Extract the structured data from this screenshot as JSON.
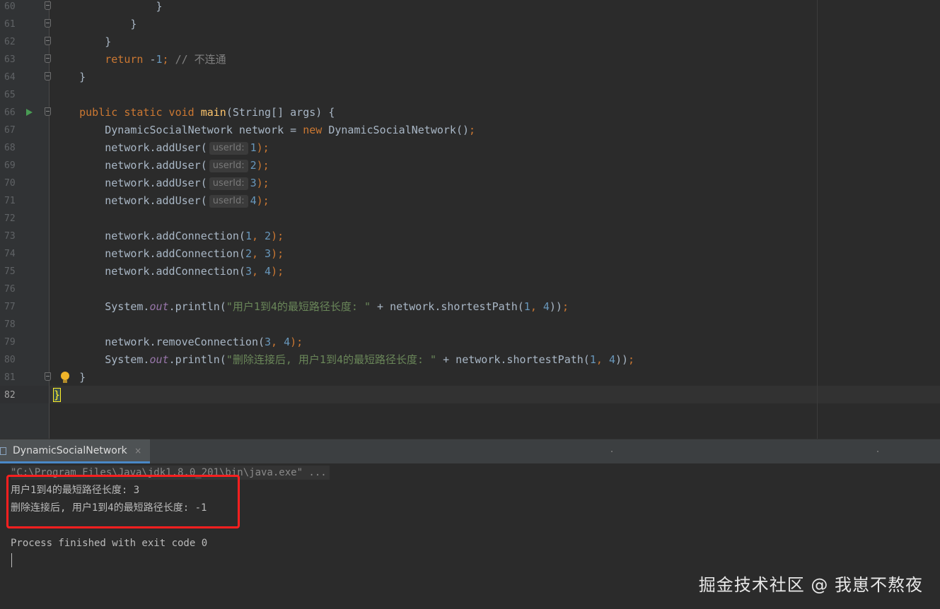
{
  "editor": {
    "lines": [
      {
        "n": "60",
        "segments": [
          {
            "t": "                }",
            "c": ""
          }
        ]
      },
      {
        "n": "61",
        "segments": [
          {
            "t": "            }",
            "c": ""
          }
        ]
      },
      {
        "n": "62",
        "segments": [
          {
            "t": "        }",
            "c": ""
          }
        ]
      },
      {
        "n": "63",
        "segments": [
          {
            "t": "        ",
            "c": ""
          },
          {
            "t": "return",
            "c": "kw"
          },
          {
            "t": " -",
            "c": ""
          },
          {
            "t": "1",
            "c": "num"
          },
          {
            "t": "; ",
            "c": "kw"
          },
          {
            "t": "// 不连通",
            "c": "cmt"
          }
        ]
      },
      {
        "n": "64",
        "segments": [
          {
            "t": "    }",
            "c": ""
          }
        ]
      },
      {
        "n": "65",
        "segments": []
      },
      {
        "n": "66",
        "segments": [
          {
            "t": "    ",
            "c": ""
          },
          {
            "t": "public static void ",
            "c": "kw"
          },
          {
            "t": "main",
            "c": "fn"
          },
          {
            "t": "(String[] args) {",
            "c": ""
          }
        ]
      },
      {
        "n": "67",
        "segments": [
          {
            "t": "        DynamicSocialNetwork network = ",
            "c": ""
          },
          {
            "t": "new ",
            "c": "kw"
          },
          {
            "t": "DynamicSocialNetwork()",
            "c": ""
          },
          {
            "t": ";",
            "c": "kw"
          }
        ]
      },
      {
        "n": "68",
        "segments": [
          {
            "t": "        network.addUser(",
            "c": ""
          },
          {
            "t": "userId:",
            "c": "hint"
          },
          {
            "t": "1",
            "c": "num"
          },
          {
            "t": ");",
            "c": "kw"
          }
        ]
      },
      {
        "n": "69",
        "segments": [
          {
            "t": "        network.addUser(",
            "c": ""
          },
          {
            "t": "userId:",
            "c": "hint"
          },
          {
            "t": "2",
            "c": "num"
          },
          {
            "t": ");",
            "c": "kw"
          }
        ]
      },
      {
        "n": "70",
        "segments": [
          {
            "t": "        network.addUser(",
            "c": ""
          },
          {
            "t": "userId:",
            "c": "hint"
          },
          {
            "t": "3",
            "c": "num"
          },
          {
            "t": ");",
            "c": "kw"
          }
        ]
      },
      {
        "n": "71",
        "segments": [
          {
            "t": "        network.addUser(",
            "c": ""
          },
          {
            "t": "userId:",
            "c": "hint"
          },
          {
            "t": "4",
            "c": "num"
          },
          {
            "t": ");",
            "c": "kw"
          }
        ]
      },
      {
        "n": "72",
        "segments": []
      },
      {
        "n": "73",
        "segments": [
          {
            "t": "        network.addConnection(",
            "c": ""
          },
          {
            "t": "1",
            "c": "num"
          },
          {
            "t": ", ",
            "c": "kw"
          },
          {
            "t": "2",
            "c": "num"
          },
          {
            "t": ");",
            "c": "kw"
          }
        ]
      },
      {
        "n": "74",
        "segments": [
          {
            "t": "        network.addConnection(",
            "c": ""
          },
          {
            "t": "2",
            "c": "num"
          },
          {
            "t": ", ",
            "c": "kw"
          },
          {
            "t": "3",
            "c": "num"
          },
          {
            "t": ");",
            "c": "kw"
          }
        ]
      },
      {
        "n": "75",
        "segments": [
          {
            "t": "        network.addConnection(",
            "c": ""
          },
          {
            "t": "3",
            "c": "num"
          },
          {
            "t": ", ",
            "c": "kw"
          },
          {
            "t": "4",
            "c": "num"
          },
          {
            "t": ");",
            "c": "kw"
          }
        ]
      },
      {
        "n": "76",
        "segments": []
      },
      {
        "n": "77",
        "segments": [
          {
            "t": "        System.",
            "c": ""
          },
          {
            "t": "out",
            "c": "fld"
          },
          {
            "t": ".println(",
            "c": ""
          },
          {
            "t": "\"用户1到4的最短路径长度: \"",
            "c": "str"
          },
          {
            "t": " + network.shortestPath(",
            "c": ""
          },
          {
            "t": "1",
            "c": "num"
          },
          {
            "t": ", ",
            "c": "kw"
          },
          {
            "t": "4",
            "c": "num"
          },
          {
            "t": "))",
            "c": ""
          },
          {
            "t": ";",
            "c": "kw"
          }
        ]
      },
      {
        "n": "78",
        "segments": []
      },
      {
        "n": "79",
        "segments": [
          {
            "t": "        network.removeConnection(",
            "c": ""
          },
          {
            "t": "3",
            "c": "num"
          },
          {
            "t": ", ",
            "c": "kw"
          },
          {
            "t": "4",
            "c": "num"
          },
          {
            "t": ");",
            "c": "kw"
          }
        ]
      },
      {
        "n": "80",
        "segments": [
          {
            "t": "        System.",
            "c": ""
          },
          {
            "t": "out",
            "c": "fld"
          },
          {
            "t": ".println(",
            "c": ""
          },
          {
            "t": "\"删除连接后, 用户1到4的最短路径长度: \"",
            "c": "str"
          },
          {
            "t": " + network.shortestPath(",
            "c": ""
          },
          {
            "t": "1",
            "c": "num"
          },
          {
            "t": ", ",
            "c": "kw"
          },
          {
            "t": "4",
            "c": "num"
          },
          {
            "t": "))",
            "c": ""
          },
          {
            "t": ";",
            "c": "kw"
          }
        ]
      },
      {
        "n": "81",
        "segments": [
          {
            "t": "    }",
            "c": ""
          }
        ]
      },
      {
        "n": "82",
        "segments": [
          {
            "t": "}",
            "c": "brace-hl"
          }
        ]
      }
    ]
  },
  "run": {
    "tab_label": "DynamicSocialNetwork",
    "close_glyph": "×",
    "console": {
      "command": "\"C:\\Program Files\\Java\\jdk1.8.0_201\\bin\\java.exe\" ...",
      "output_1": "用户1到4的最短路径长度: 3",
      "output_2": "删除连接后, 用户1到4的最短路径长度: -1",
      "exit_message": "Process finished with exit code 0"
    }
  },
  "watermark": "掘金技术社区 @ 我崽不熬夜"
}
